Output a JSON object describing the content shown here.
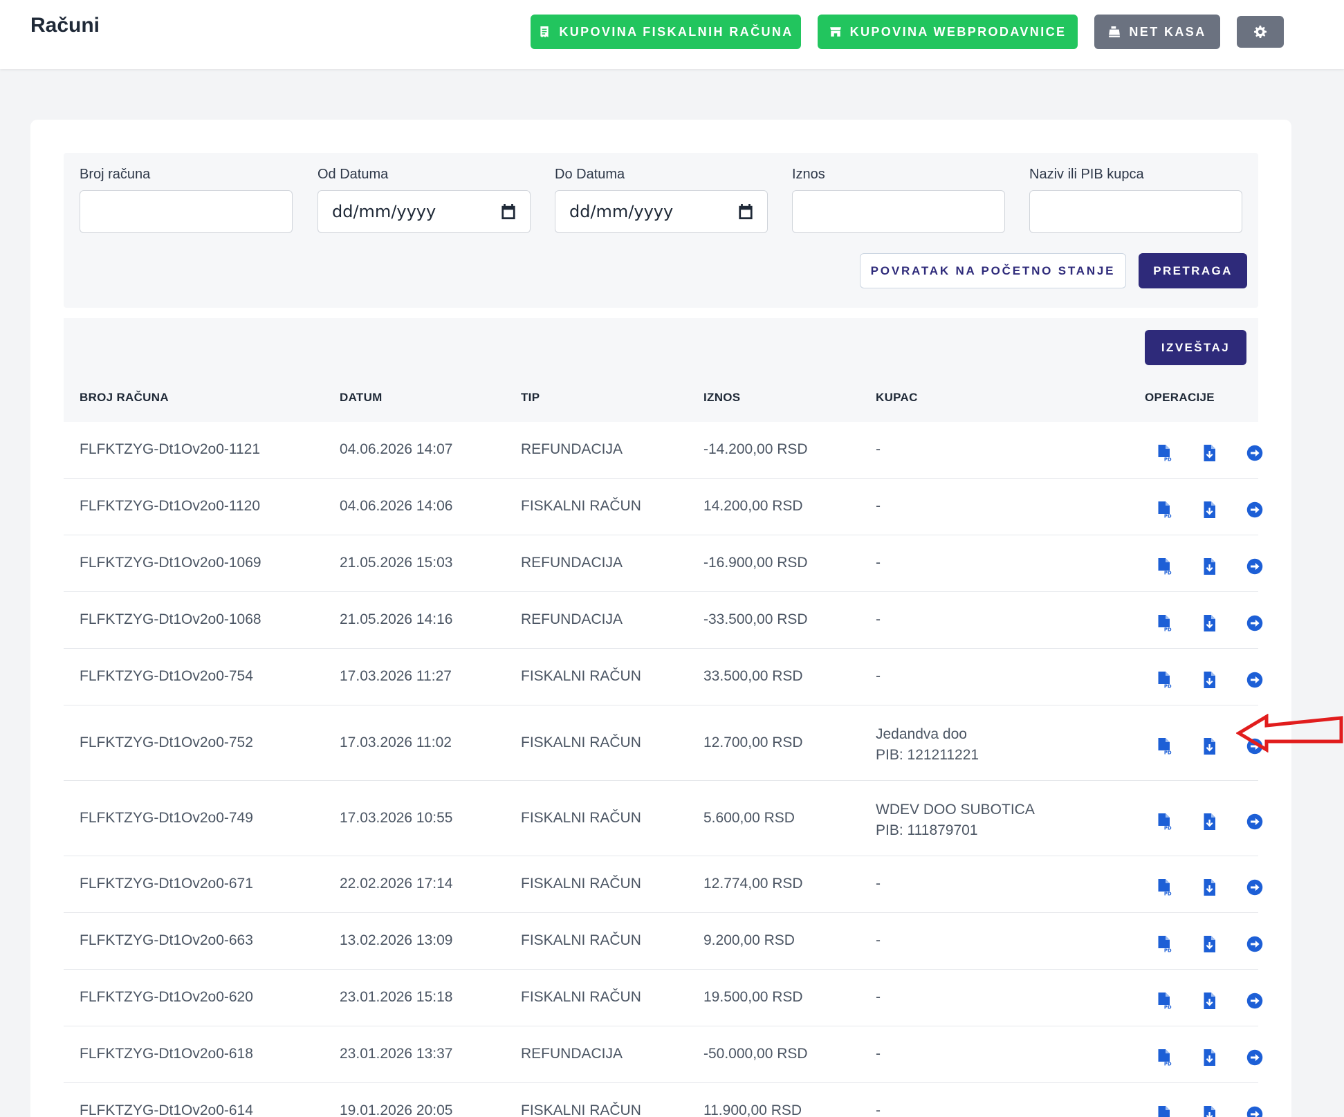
{
  "page": {
    "title": "Računi"
  },
  "topbar": {
    "btn_fiskalni": "KUPOVINA FISKALNIH RAČUNA",
    "btn_web": "KUPOVINA WEBPRODAVNICE",
    "btn_netkasa": "NET KASA"
  },
  "filters": {
    "broj_label": "Broj računa",
    "od_label": "Od Datuma",
    "do_label": "Do Datuma",
    "iznos_label": "Iznos",
    "kupac_label": "Naziv ili PIB kupca",
    "od_value": "dd/mm/yyyy",
    "do_value": "dd/mm/yyyy",
    "reset_label": "POVRATAK NA POČETNO STANJE",
    "search_label": "PRETRAGA"
  },
  "report_label": "IZVEŠTAJ",
  "columns": [
    "BROJ RAČUNA",
    "DATUM",
    "TIP",
    "IZNOS",
    "KUPAC",
    "OPERACIJE"
  ],
  "rows": [
    {
      "broj": "FLFKTZYG-Dt1Ov2o0-1121",
      "datum": "04.06.2026 14:07",
      "tip": "REFUNDACIJA",
      "iznos": "-14.200,00 RSD",
      "kupac": "-",
      "pib": ""
    },
    {
      "broj": "FLFKTZYG-Dt1Ov2o0-1120",
      "datum": "04.06.2026 14:06",
      "tip": "FISKALNI RAČUN",
      "iznos": "14.200,00 RSD",
      "kupac": "-",
      "pib": ""
    },
    {
      "broj": "FLFKTZYG-Dt1Ov2o0-1069",
      "datum": "21.05.2026 15:03",
      "tip": "REFUNDACIJA",
      "iznos": "-16.900,00 RSD",
      "kupac": "-",
      "pib": ""
    },
    {
      "broj": "FLFKTZYG-Dt1Ov2o0-1068",
      "datum": "21.05.2026 14:16",
      "tip": "REFUNDACIJA",
      "iznos": "-33.500,00 RSD",
      "kupac": "-",
      "pib": ""
    },
    {
      "broj": "FLFKTZYG-Dt1Ov2o0-754",
      "datum": "17.03.2026 11:27",
      "tip": "FISKALNI RAČUN",
      "iznos": "33.500,00 RSD",
      "kupac": "-",
      "pib": ""
    },
    {
      "broj": "FLFKTZYG-Dt1Ov2o0-752",
      "datum": "17.03.2026 11:02",
      "tip": "FISKALNI RAČUN",
      "iznos": "12.700,00 RSD",
      "kupac": "Jedandva doo",
      "pib": "PIB: 121211221"
    },
    {
      "broj": "FLFKTZYG-Dt1Ov2o0-749",
      "datum": "17.03.2026 10:55",
      "tip": "FISKALNI RAČUN",
      "iznos": "5.600,00 RSD",
      "kupac": "WDEV DOO SUBOTICA",
      "pib": "PIB: 111879701"
    },
    {
      "broj": "FLFKTZYG-Dt1Ov2o0-671",
      "datum": "22.02.2026 17:14",
      "tip": "FISKALNI RAČUN",
      "iznos": "12.774,00 RSD",
      "kupac": "-",
      "pib": ""
    },
    {
      "broj": "FLFKTZYG-Dt1Ov2o0-663",
      "datum": "13.02.2026 13:09",
      "tip": "FISKALNI RAČUN",
      "iznos": "9.200,00 RSD",
      "kupac": "-",
      "pib": ""
    },
    {
      "broj": "FLFKTZYG-Dt1Ov2o0-620",
      "datum": "23.01.2026 15:18",
      "tip": "FISKALNI RAČUN",
      "iznos": "19.500,00 RSD",
      "kupac": "-",
      "pib": ""
    },
    {
      "broj": "FLFKTZYG-Dt1Ov2o0-618",
      "datum": "23.01.2026 13:37",
      "tip": "REFUNDACIJA",
      "iznos": "-50.000,00 RSD",
      "kupac": "-",
      "pib": ""
    },
    {
      "broj": "FLFKTZYG-Dt1Ov2o0-614",
      "datum": "19.01.2026 20:05",
      "tip": "FISKALNI RAČUN",
      "iznos": "11.900,00 RSD",
      "kupac": "-",
      "pib": ""
    }
  ],
  "icons": {
    "pdf": "file-pdf-icon",
    "download": "file-download-icon",
    "open": "arrow-circle-right-icon",
    "settings": "gear-icon"
  },
  "colors": {
    "green": "#22c55e",
    "gray": "#6b7280",
    "primary": "#2e2a7a",
    "icon_blue": "#1d5fd6",
    "annotation_red": "#e11d1d"
  }
}
